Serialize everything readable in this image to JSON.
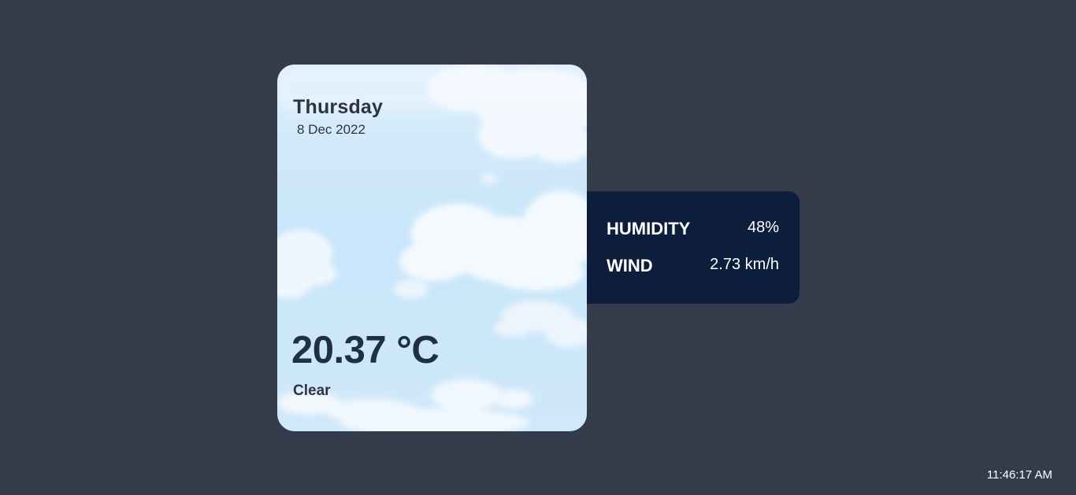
{
  "weather_card": {
    "day": "Thursday",
    "date": "8 Dec 2022",
    "temperature": "20.37 °C",
    "condition": "Clear"
  },
  "details": {
    "humidity": {
      "label": "HUMIDITY",
      "value": "48%"
    },
    "wind": {
      "label": "WIND",
      "value": "2.73 km/h"
    }
  },
  "clock": {
    "time": "11:46:17 AM"
  },
  "colors": {
    "background": "#343c4c",
    "details_panel": "#0d1e3d",
    "card_text": "#2d3440",
    "temperature_text": "#1f3140"
  }
}
